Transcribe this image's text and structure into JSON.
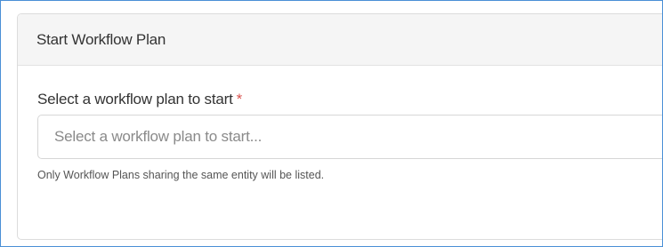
{
  "panel": {
    "title": "Start Workflow Plan"
  },
  "form": {
    "label": "Select a workflow plan to start",
    "required_marker": "*",
    "select_placeholder": "Select a workflow plan to start...",
    "help_text": "Only Workflow Plans sharing the same entity will be listed."
  },
  "colors": {
    "required": "#d9534f",
    "frame_border": "#4a8fd6",
    "header_bg": "#f5f5f5"
  }
}
